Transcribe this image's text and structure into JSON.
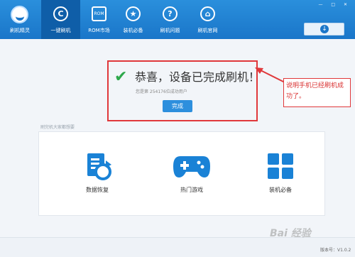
{
  "brand": {
    "label": "刷机精灵"
  },
  "nav": [
    {
      "label": "一键刷机",
      "icon": "refresh-c-icon"
    },
    {
      "label": "ROM市场",
      "icon": "rom-icon",
      "icon_text": "ROM"
    },
    {
      "label": "装机必备",
      "icon": "star-icon",
      "icon_text": "★"
    },
    {
      "label": "刷机问题",
      "icon": "question-icon",
      "icon_text": "?"
    },
    {
      "label": "刷机官网",
      "icon": "home-icon",
      "icon_text": "⌂"
    }
  ],
  "success": {
    "title": "恭喜，设备已完成刷机！",
    "subtitle": "您是第 254176位成功用户",
    "button": "完成"
  },
  "annotation": {
    "text": "说明手机已经刷机成功了。"
  },
  "recommend": {
    "heading": "刷完机大家都想要",
    "items": [
      {
        "label": "数据恢复",
        "icon": "data-recovery-icon"
      },
      {
        "label": "热门游戏",
        "icon": "gamepad-icon"
      },
      {
        "label": "装机必备",
        "icon": "apps-grid-icon"
      }
    ]
  },
  "footer": {
    "version": "版本号：V1.0.2"
  },
  "watermark": {
    "text": "Bai 经验"
  },
  "colors": {
    "accent": "#1a76c9",
    "success": "#2ea84b",
    "highlight": "#e0383b"
  }
}
